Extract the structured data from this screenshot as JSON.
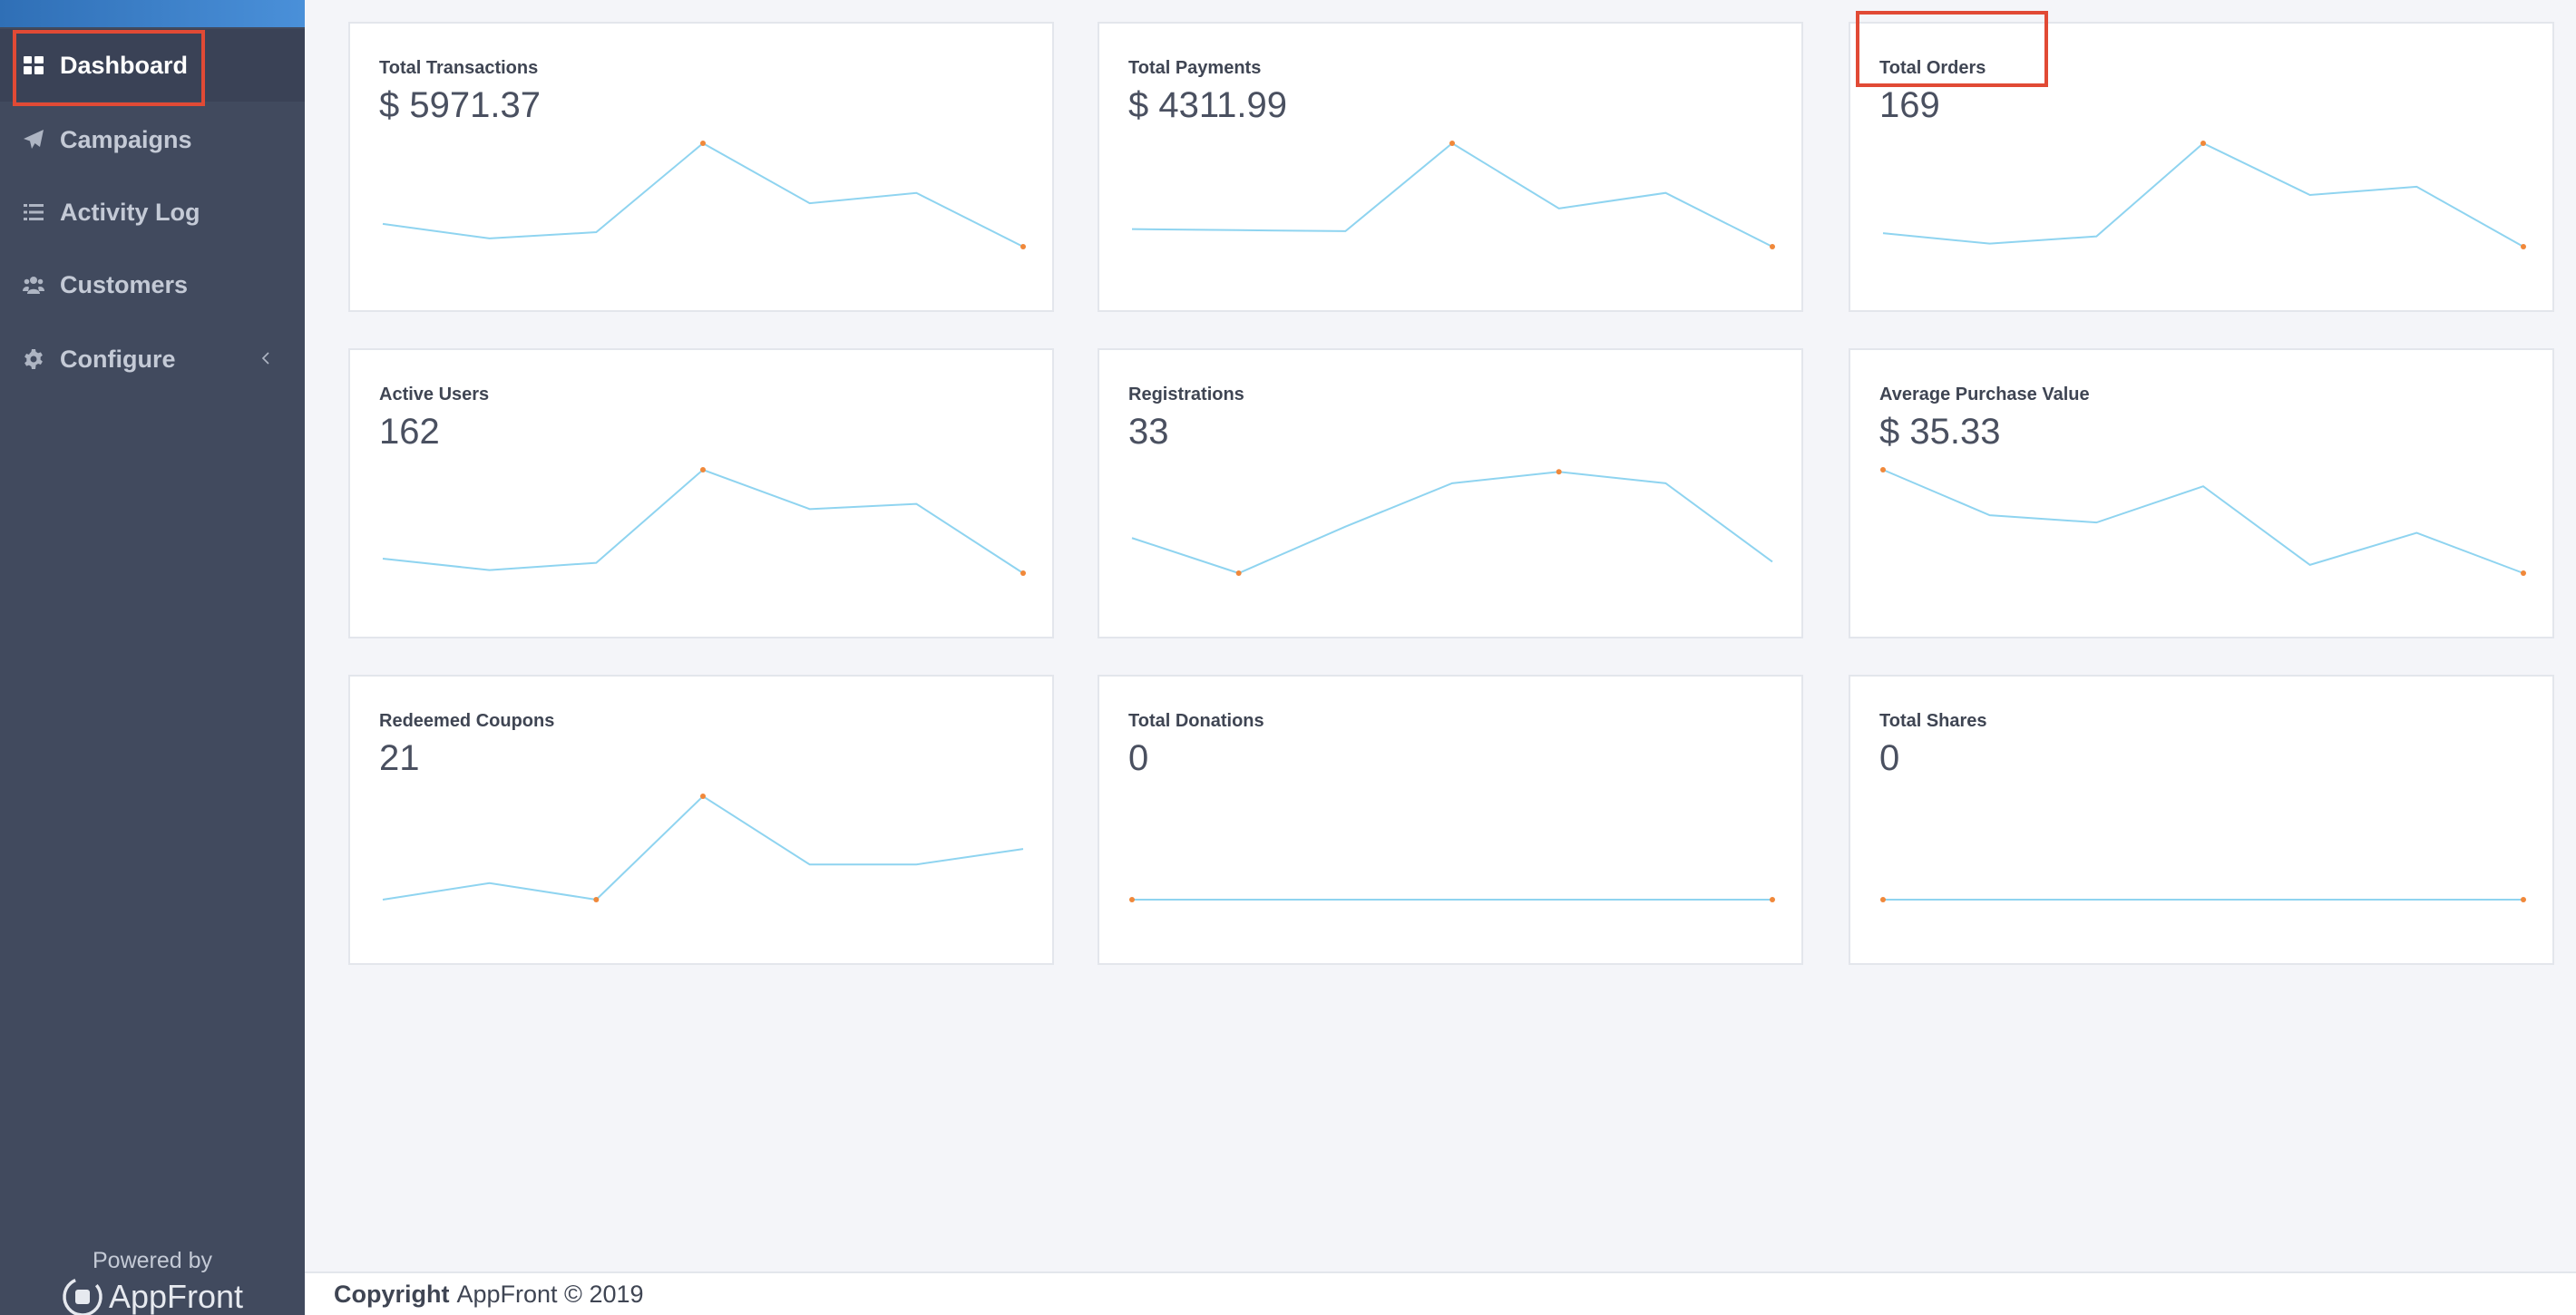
{
  "sidebar": {
    "items": [
      {
        "label": "Dashboard",
        "icon": "grid-icon",
        "active": true
      },
      {
        "label": "Campaigns",
        "icon": "paper-plane-icon"
      },
      {
        "label": "Activity Log",
        "icon": "list-icon"
      },
      {
        "label": "Customers",
        "icon": "users-icon"
      },
      {
        "label": "Configure",
        "icon": "gear-icon"
      }
    ],
    "powered_by": "Powered by",
    "brand": "AppFront"
  },
  "cards": [
    {
      "title": "Total Transactions",
      "value": "$ 5971.37",
      "series": [
        0.22,
        0.08,
        0.14,
        1.0,
        0.42,
        0.52,
        0.0
      ]
    },
    {
      "title": "Total Payments",
      "value": "$ 4311.99",
      "series": [
        0.17,
        0.16,
        0.15,
        1.0,
        0.37,
        0.52,
        0.0
      ]
    },
    {
      "title": "Total Orders",
      "value": "169",
      "series": [
        0.13,
        0.03,
        0.1,
        1.0,
        0.5,
        0.58,
        0.0
      ]
    },
    {
      "title": "Active Users",
      "value": "162",
      "series": [
        0.14,
        0.03,
        0.1,
        1.0,
        0.62,
        0.67,
        0.0
      ]
    },
    {
      "title": "Registrations",
      "value": "33",
      "series": [
        0.34,
        0.0,
        0.45,
        0.87,
        0.98,
        0.87,
        0.11
      ]
    },
    {
      "title": "Average Purchase Value",
      "value": "$ 35.33",
      "series": [
        1.0,
        0.56,
        0.49,
        0.84,
        0.08,
        0.39,
        0.0
      ]
    },
    {
      "title": "Redeemed Coupons",
      "value": "21",
      "series": [
        0.0,
        0.16,
        0.0,
        1.0,
        0.34,
        0.34,
        0.49
      ]
    },
    {
      "title": "Total Donations",
      "value": "0",
      "series": [
        0,
        0,
        0,
        0,
        0,
        0,
        0
      ]
    },
    {
      "title": "Total Shares",
      "value": "0",
      "series": [
        0,
        0,
        0,
        0,
        0,
        0,
        0
      ]
    }
  ],
  "footer": {
    "bold": "Copyright",
    "text": "AppFront © 2019"
  },
  "colors": {
    "sidebar_bg": "#414a5e",
    "line": "#8fd4f0",
    "marker": "#f0883a",
    "highlight": "#e14a35"
  }
}
